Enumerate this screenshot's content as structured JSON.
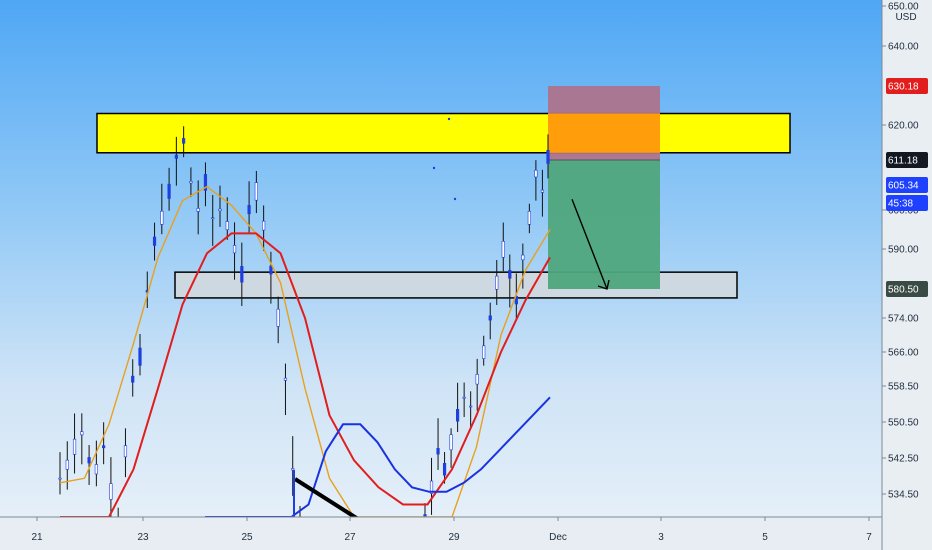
{
  "chart_data": {
    "type": "candlestick",
    "currency_label": "USD",
    "x_tick_labels": [
      "21",
      "23",
      "25",
      "27",
      "29",
      "Dec",
      "3",
      "5",
      "7"
    ],
    "y_tick_labels": [
      "650.00",
      "640.00",
      "620.00",
      "600.00",
      "590.00",
      "574.00",
      "566.00",
      "558.50",
      "550.50",
      "542.50",
      "534.50"
    ],
    "y_ticks": [
      650.0,
      640.0,
      620.0,
      600.0,
      590.0,
      574.0,
      566.0,
      558.5,
      550.5,
      542.5,
      534.5
    ],
    "ylim": [
      529,
      651
    ],
    "price_badges": [
      {
        "id": "stop",
        "value": 630.18,
        "label": "630.18",
        "color": "#e11d1d"
      },
      {
        "id": "last",
        "value": 611.18,
        "label": "611.18",
        "color": "#131722"
      },
      {
        "id": "current",
        "value": 605.34,
        "label": "605.34",
        "color": "#1e40ff"
      },
      {
        "id": "countdown",
        "value": 601.5,
        "label": "45:38",
        "color": "#1e40ff"
      },
      {
        "id": "target",
        "value": 580.5,
        "label": "580.50",
        "color": "#3a4a44"
      }
    ],
    "zones": [
      {
        "name": "resistance",
        "color": "#ffff00",
        "price_low": 613.0,
        "price_high": 623.0
      },
      {
        "name": "support",
        "color": "#d4d8dd",
        "price_low": 578.5,
        "price_high": 584.5
      }
    ],
    "trade": {
      "direction": "short",
      "entry": 611.18,
      "stop": 630.18,
      "target": 580.5,
      "risk_color": "#b07088",
      "reward_color": "#4ea67c",
      "overlap_color": "#ff9d0a"
    },
    "series": [
      {
        "line_color": "#e8a020",
        "x": [
          0,
          0.5,
          1,
          1.5,
          2,
          2.5,
          3,
          3.5,
          4,
          4.5,
          5,
          5.5,
          6,
          6.5,
          7,
          7.5,
          8,
          8.5,
          9,
          9.5,
          10
        ],
        "values": [
          537,
          538,
          550,
          568,
          588,
          602,
          605,
          601,
          594,
          582,
          558,
          538,
          520,
          510,
          505,
          512,
          525,
          545,
          570,
          585,
          595
        ]
      },
      {
        "line_color": "#e11d1d",
        "x": [
          0,
          0.5,
          1,
          1.5,
          2,
          2.5,
          3,
          3.5,
          4,
          4.5,
          5,
          5.5,
          6,
          6.5,
          7,
          7.5,
          8,
          8.5,
          9,
          9.5,
          10
        ],
        "values": [
          525,
          526,
          528,
          540,
          558,
          577,
          589,
          594,
          594,
          589,
          574,
          552,
          542,
          536,
          532,
          532,
          540,
          552,
          566,
          578,
          588
        ]
      },
      {
        "line_color": "#1a33e0",
        "x": [
          0,
          1,
          2,
          2.5,
          3,
          3.5,
          4,
          4.5,
          5,
          5.5,
          6,
          6.5,
          7,
          7.5,
          8,
          8.5,
          9,
          9.5,
          10
        ],
        "values": [
          500,
          505,
          512,
          520,
          532,
          544,
          550,
          550,
          546,
          540,
          536,
          535,
          535,
          537,
          540,
          544,
          548,
          552,
          556
        ]
      }
    ],
    "candles": [
      [
        0,
        538
      ],
      [
        0.3,
        541
      ],
      [
        0.6,
        545
      ],
      [
        0.9,
        548
      ],
      [
        1.2,
        542
      ],
      [
        1.5,
        540
      ],
      [
        1.8,
        545
      ],
      [
        2.1,
        535
      ],
      [
        2.4,
        526
      ],
      [
        2.7,
        544
      ],
      [
        3.0,
        560
      ],
      [
        3.3,
        565
      ],
      [
        3.6,
        580
      ],
      [
        3.9,
        592
      ],
      [
        4.2,
        598
      ],
      [
        4.5,
        604
      ],
      [
        4.8,
        612
      ],
      [
        5.1,
        616
      ],
      [
        5.4,
        606
      ],
      [
        5.7,
        600
      ],
      [
        6.0,
        606
      ],
      [
        6.3,
        598
      ],
      [
        6.6,
        600
      ],
      [
        6.9,
        596
      ],
      [
        7.2,
        590
      ],
      [
        7.5,
        584
      ],
      [
        7.8,
        600
      ],
      [
        8.1,
        604
      ],
      [
        8.4,
        596
      ],
      [
        8.7,
        585
      ],
      [
        9.0,
        574
      ],
      [
        9.3,
        560
      ],
      [
        9.6,
        540
      ],
      [
        9.9,
        528
      ]
    ],
    "candles2": [
      [
        0,
        528
      ],
      [
        0.35,
        536
      ],
      [
        0.7,
        544
      ],
      [
        1.05,
        540
      ],
      [
        1.4,
        546
      ],
      [
        1.75,
        552
      ],
      [
        2.1,
        556
      ],
      [
        2.45,
        554
      ],
      [
        2.8,
        560
      ],
      [
        3.15,
        566
      ],
      [
        3.5,
        574
      ],
      [
        3.85,
        582
      ],
      [
        4.2,
        590
      ],
      [
        4.55,
        584
      ],
      [
        4.9,
        578
      ],
      [
        5.25,
        588
      ],
      [
        5.6,
        598
      ],
      [
        5.95,
        608
      ],
      [
        6.3,
        604
      ],
      [
        6.6,
        612
      ]
    ],
    "projection_arrow": {
      "from_price": 602.3,
      "to_price": 580.5
    }
  }
}
